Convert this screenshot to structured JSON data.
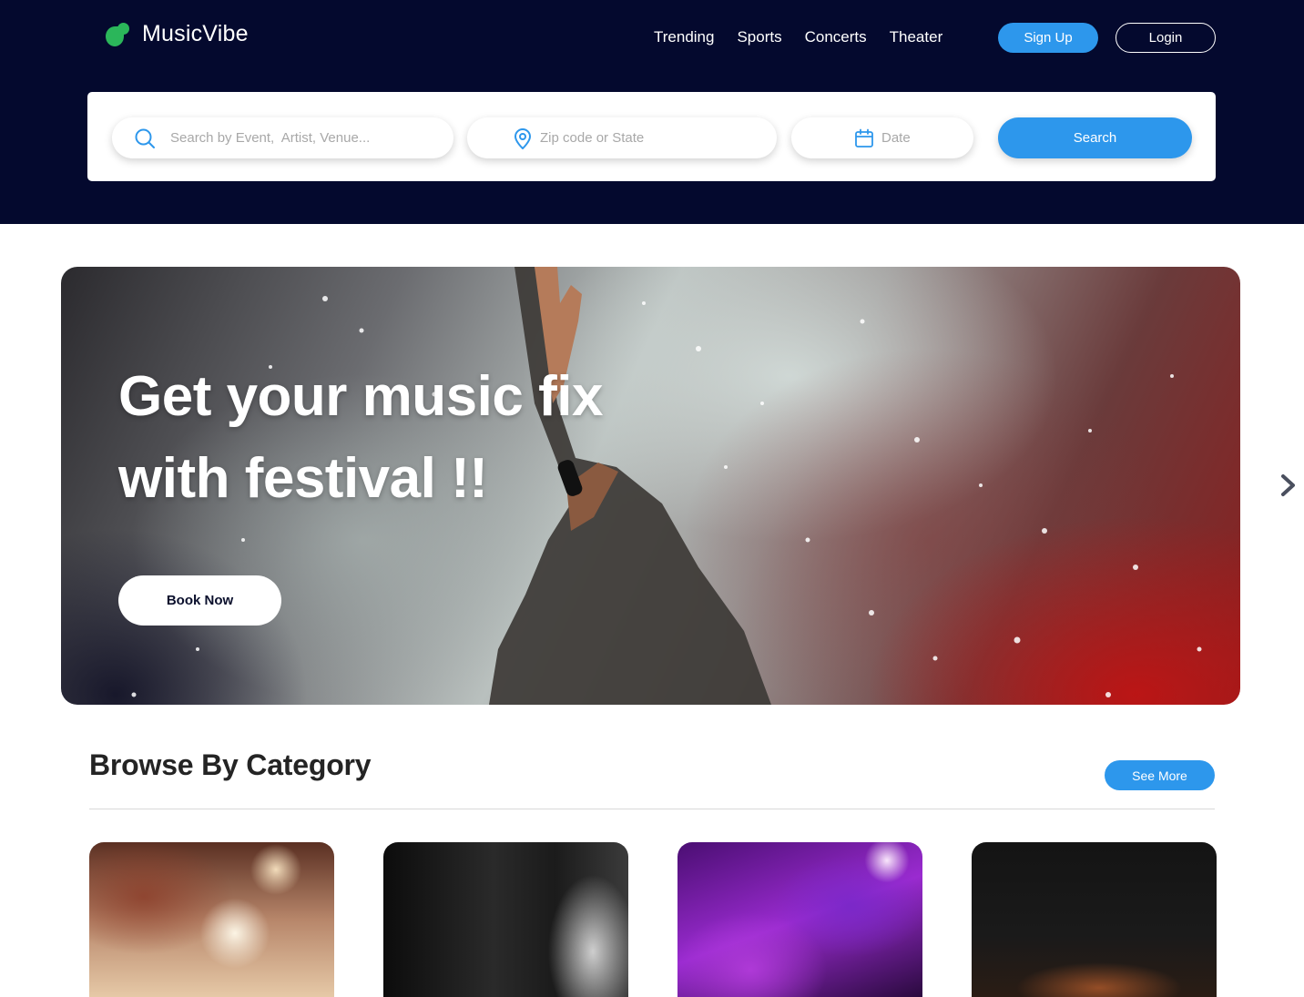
{
  "brand": {
    "name": "MusicVibe",
    "accent": "#2bb65a"
  },
  "nav": {
    "items": [
      {
        "label": "Trending"
      },
      {
        "label": "Sports"
      },
      {
        "label": "Concerts"
      },
      {
        "label": "Theater"
      }
    ]
  },
  "auth": {
    "signup_label": "Sign Up",
    "login_label": "Login"
  },
  "search": {
    "query_placeholder": "Search by Event,  Artist, Venue...",
    "location_placeholder": "Zip code or State",
    "date_placeholder": "Date",
    "button_label": "Search"
  },
  "hero": {
    "title_line1": "Get your music fix",
    "title_line2": "with festival !!",
    "cta_label": "Book Now"
  },
  "categories": {
    "title": "Browse By Category",
    "see_more_label": "See More"
  },
  "colors": {
    "header_bg": "#04092e",
    "primary": "#2d97ec",
    "text_dark": "#242424"
  }
}
